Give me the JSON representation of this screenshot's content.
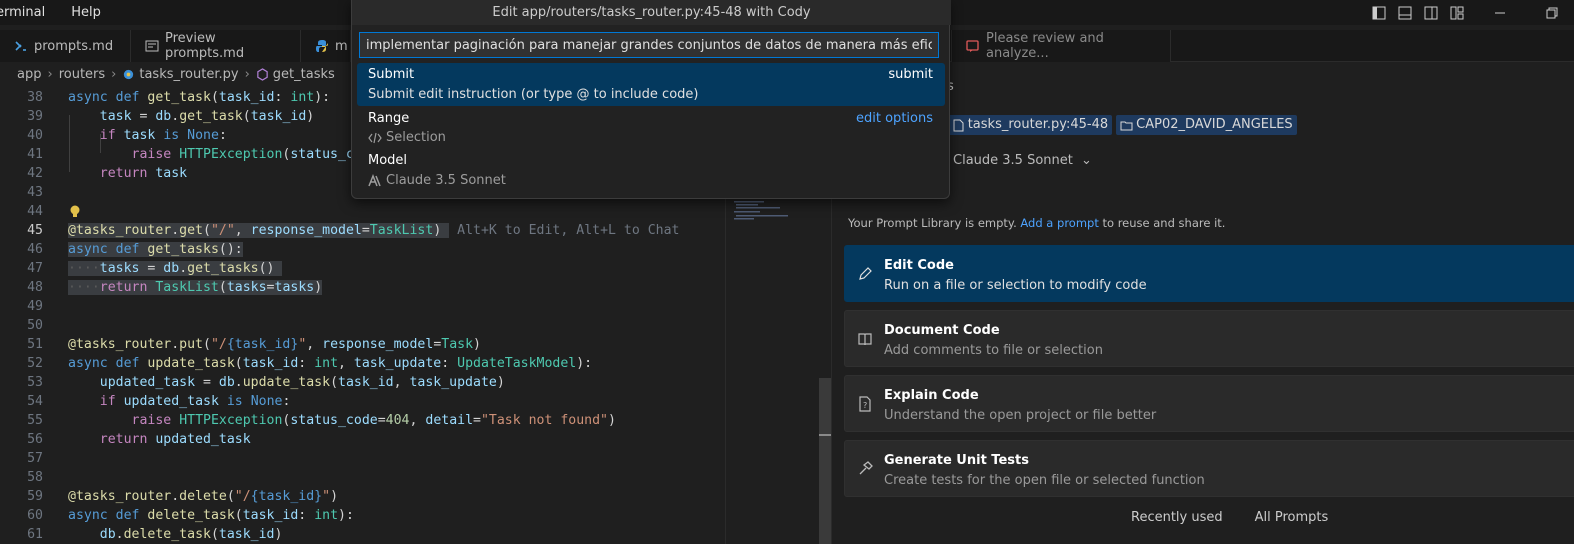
{
  "menu": {
    "terminal": "erminal",
    "help": "Help"
  },
  "tabs": [
    {
      "label": "prompts.md"
    },
    {
      "label": "Preview prompts.md"
    },
    {
      "label": "m"
    },
    {
      "label": "Please review and analyze..."
    }
  ],
  "breadcrumb": {
    "app": "app",
    "routers": "routers",
    "file": "tasks_router.py",
    "symbol": "get_tasks"
  },
  "editor": {
    "lines": {
      "l38": "38",
      "l39": "39",
      "l40": "40",
      "l41": "41",
      "l42": "42",
      "l43": "43",
      "l44": "44",
      "l45": "45",
      "l46": "46",
      "l47": "47",
      "l48": "48",
      "l49": "49",
      "l50": "50",
      "l51": "51",
      "l52": "52",
      "l53": "53",
      "l54": "54",
      "l55": "55",
      "l56": "56",
      "l57": "57",
      "l58": "58",
      "l59": "59",
      "l60": "60",
      "l61": "61"
    },
    "inline_hint": "Alt+K to Edit, Alt+L to Chat"
  },
  "dialog": {
    "title": "Edit app/routers/tasks_router.py:45-48 with Cody",
    "input_value": "implementar paginación para manejar grandes conjuntos de datos de manera más eficiente",
    "submit_title": "Submit",
    "submit_desc": "Submit edit instruction (or type @ to include code)",
    "submit_key": "submit",
    "range_title": "Range",
    "range_value": "Selection",
    "range_link": "edit options",
    "model_title": "Model",
    "model_value": "Claude 3.5 Sonnet"
  },
  "panel": {
    "header_fragment": "s",
    "chip_fragment": "y",
    "chip_file": "tasks_router.py:45-48",
    "chip_folder": "CAP02_DAVID_ANGELES",
    "model": "Claude 3.5 Sonnet",
    "library_text_a": "Your Prompt Library is empty.",
    "library_link": "Add a prompt",
    "library_text_b": "to reuse and share it.",
    "commands": [
      {
        "title": "Edit Code",
        "desc": "Run on a file or selection to modify code"
      },
      {
        "title": "Document Code",
        "desc": "Add comments to file or selection"
      },
      {
        "title": "Explain Code",
        "desc": "Understand the open project or file better"
      },
      {
        "title": "Generate Unit Tests",
        "desc": "Create tests for the open file or selected function"
      }
    ],
    "bottom_tabs": {
      "recent": "Recently used",
      "all": "All Prompts"
    }
  },
  "colors": {
    "accent": "#0078d4",
    "selection": "#04395e",
    "chip": "#1e3a5f"
  }
}
